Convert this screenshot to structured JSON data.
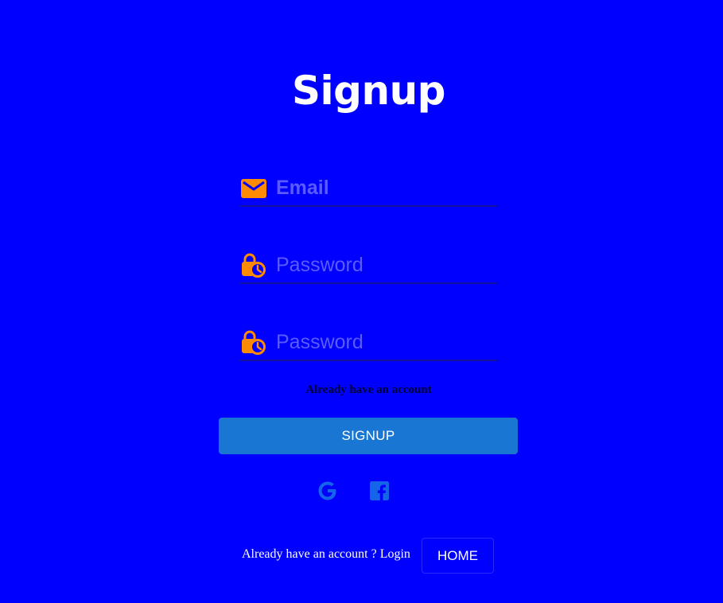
{
  "page": {
    "title": "Signup"
  },
  "form": {
    "email": {
      "placeholder": "Email",
      "value": "",
      "icon": "mail-icon"
    },
    "password": {
      "placeholder": "Password",
      "value": "",
      "icon": "lock-clock-icon"
    },
    "confirm_password": {
      "placeholder": "Password",
      "value": "",
      "icon": "lock-clock-icon"
    },
    "hint": "Already have an account",
    "submit_label": "SIGNUP"
  },
  "social": {
    "google_icon": "google-icon",
    "facebook_icon": "facebook-icon"
  },
  "footer": {
    "text": "Already have an account ? Login",
    "home_label": "HOME"
  },
  "colors": {
    "background": "#0000ff",
    "icon_accent": "#ff8c00",
    "button": "#1976d2",
    "social": "#1565e8"
  }
}
